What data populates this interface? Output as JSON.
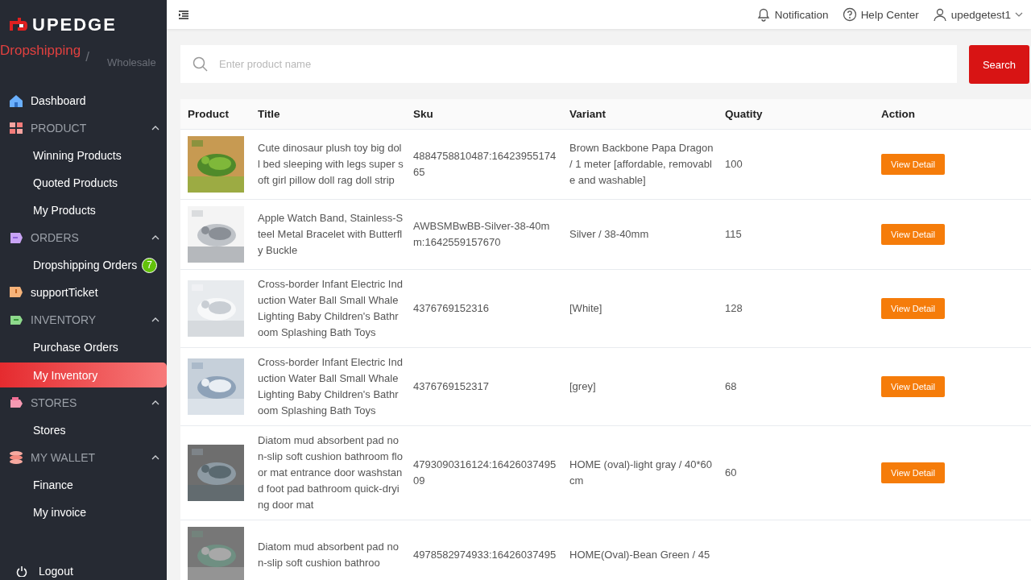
{
  "sidebar": {
    "logo": "UPEDGE",
    "modes": [
      {
        "label": "Dropshipping",
        "selected": true
      },
      {
        "label": "Wholesale",
        "selected": false
      }
    ],
    "mode_separator": "/",
    "items": [
      {
        "kind": "link",
        "label": "Dashboard",
        "selected": false
      },
      {
        "kind": "group",
        "label": "PRODUCT",
        "expanded": true,
        "children": [
          {
            "label": "Winning Products",
            "selected": false
          },
          {
            "label": "Quoted Products",
            "selected": false
          },
          {
            "label": "My Products",
            "selected": false
          }
        ]
      },
      {
        "kind": "group",
        "label": "ORDERS",
        "expanded": true,
        "children": [
          {
            "label": "Dropshipping Orders",
            "selected": false,
            "badge": "7"
          }
        ]
      },
      {
        "kind": "link",
        "label": "supportTicket",
        "selected": false
      },
      {
        "kind": "group",
        "label": "INVENTORY",
        "expanded": true,
        "children": [
          {
            "label": "Purchase Orders",
            "selected": false
          },
          {
            "label": "My Inventory",
            "selected": true
          }
        ]
      },
      {
        "kind": "group",
        "label": "STORES",
        "expanded": true,
        "children": [
          {
            "label": "Stores",
            "selected": false
          }
        ]
      },
      {
        "kind": "group",
        "label": "MY WALLET",
        "expanded": true,
        "children": [
          {
            "label": "Finance",
            "selected": false
          },
          {
            "label": "My invoice",
            "selected": false
          }
        ]
      }
    ],
    "logout": "Logout"
  },
  "header": {
    "links": [
      {
        "kind": "notification",
        "label": "Notification"
      },
      {
        "kind": "help",
        "label": "Help Center"
      },
      {
        "kind": "user",
        "label": "upedgetest1"
      }
    ]
  },
  "search": {
    "placeholder": "Enter product name",
    "button": "Search"
  },
  "table": {
    "columns": [
      "Product",
      "Title",
      "Sku",
      "Variant",
      "Quatity",
      "Action"
    ],
    "rows": [
      {
        "title": "Cute dinosaur plush toy big doll bed sleeping with legs super soft girl pillow doll rag doll strip",
        "sku": "4884758810487:1642395517465",
        "variant": "Brown Backbone Papa Dragon / 1 meter [affordable, removable and washable]",
        "quantity": "100",
        "action": "View Detail"
      },
      {
        "title": "Apple Watch Band, Stainless-Steel Metal Bracelet with Butterfly Buckle",
        "sku": "AWBSMBwBB-Silver-38-40mm:1642559157670",
        "variant": "Silver / 38-40mm",
        "quantity": "115",
        "action": "View Detail"
      },
      {
        "title": "Cross-border Infant Electric Induction Water Ball Small Whale Lighting Baby Children's Bathroom Splashing Bath Toys",
        "sku": "4376769152316",
        "variant": "[White]",
        "quantity": "128",
        "action": "View Detail"
      },
      {
        "title": "Cross-border Infant Electric Induction Water Ball Small Whale Lighting Baby Children's Bathroom Splashing Bath Toys",
        "sku": "4376769152317",
        "variant": "[grey]",
        "quantity": "68",
        "action": "View Detail"
      },
      {
        "title": "Diatom mud absorbent pad non-slip soft cushion bathroom floor mat entrance door washstand foot pad bathroom quick-drying door mat",
        "sku": "4793090316124:1642603749509",
        "variant": "HOME (oval)-light gray / 40*60cm",
        "quantity": "60",
        "action": "View Detail"
      },
      {
        "title": "Diatom mud absorbent pad non-slip soft cushion bathroo",
        "sku": "4978582974933:16426037495",
        "variant": "HOME(Oval)-Bean Green / 45"
      }
    ]
  }
}
